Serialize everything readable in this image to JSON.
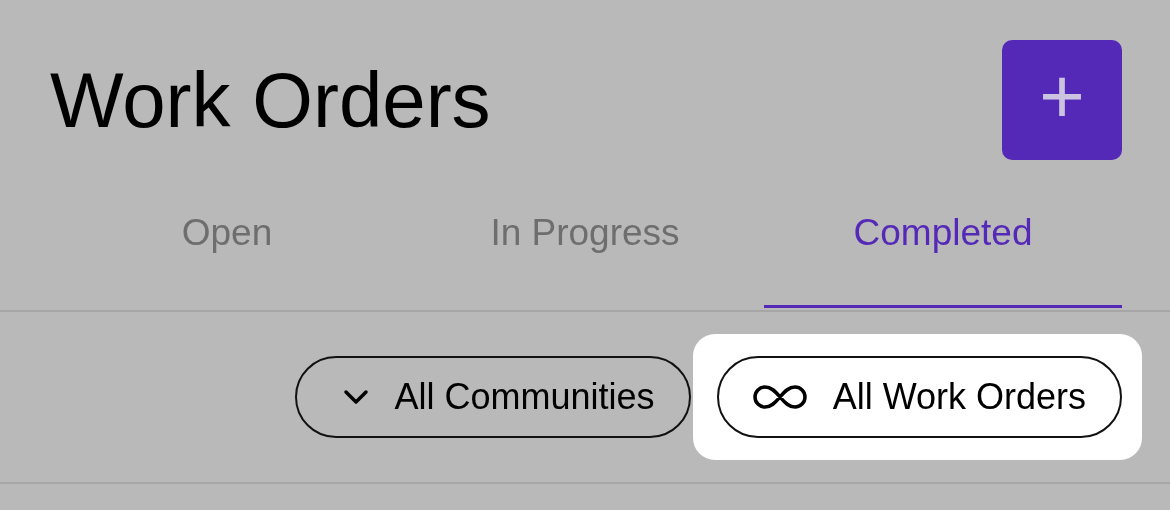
{
  "header": {
    "title": "Work Orders",
    "add_button": "+"
  },
  "tabs": [
    {
      "label": "Open",
      "selected": false
    },
    {
      "label": "In Progress",
      "selected": false
    },
    {
      "label": "Completed",
      "selected": true
    }
  ],
  "filters": [
    {
      "label": "All Communities",
      "kind": "dropdown",
      "highlighted": false
    },
    {
      "label": "All Work Orders",
      "kind": "all",
      "highlighted": true
    }
  ]
}
